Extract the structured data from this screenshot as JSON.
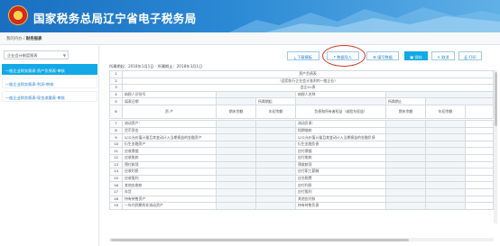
{
  "app": {
    "title": "国家税务总局辽宁省电子税务局"
  },
  "breadcrumb": {
    "home": "我的待办",
    "sep": "/",
    "current": "财务报表"
  },
  "sidebar": {
    "type_select": "企业会计制度报表",
    "items": [
      {
        "label": "一般企业财务报表-资产负债表-审核"
      },
      {
        "label": "一般企业财务报表-利润-审核"
      },
      {
        "label": "一般企业财务报表-现金流量表-审核"
      }
    ]
  },
  "toolbar": {
    "download": "下载模板",
    "import": "数据导入",
    "history": "填写数据",
    "save": "保存",
    "cancel": "取消",
    "print": "打印"
  },
  "period": {
    "text": "所属期起：2018年1月1日 - 所属期止：2018年3月1日"
  },
  "sheet": {
    "title": "资产负债表",
    "subtitle": "（适用执行企业会计准则的一般企业）",
    "unit": "会企01表",
    "row4": {
      "a": "纳税人识别号",
      "b": "纳税人名称"
    },
    "row5": {
      "a": "填表日期",
      "b": "所属期起",
      "c": "所属期止"
    },
    "row6": {
      "asset": "资 产",
      "end": "期末余额",
      "begin": "年初余额",
      "liab": "负债和所有者权益（或股东权益）",
      "end2": "期末余额",
      "begin2": "年初余额"
    },
    "items": [
      {
        "n": "7",
        "a": "流动资产：",
        "b": "流动负债："
      },
      {
        "n": "8",
        "a": "货币资金",
        "b": "短期借款"
      },
      {
        "n": "9",
        "a": "以公允价值计量且其变动计入当期损益的金融资产",
        "b": "以公允价值计量且其变动计入当期损益的金融负债"
      },
      {
        "n": "10",
        "a": "衍生金融资产",
        "b": "衍生金融负债"
      },
      {
        "n": "11",
        "a": "应收票据",
        "b": "应付票据"
      },
      {
        "n": "12",
        "a": "应收账款",
        "b": "应付账款"
      },
      {
        "n": "13",
        "a": "预付款项",
        "b": "预收款项"
      },
      {
        "n": "14",
        "a": "应收利息",
        "b": "应付职工薪酬"
      },
      {
        "n": "15",
        "a": "应收股利",
        "b": "应交税费"
      },
      {
        "n": "16",
        "a": "其他应收款",
        "b": "应付利息"
      },
      {
        "n": "17",
        "a": "存货",
        "b": "应付股利"
      },
      {
        "n": "18",
        "a": "持有待售资产",
        "b": "其他应付款"
      },
      {
        "n": "19",
        "a": "一年内到期的非流动资产",
        "b": "持有待售负债"
      }
    ]
  },
  "colors": {
    "header": "#1a6fc0",
    "accent": "#12a9e6",
    "highlight": "#d83a2c"
  }
}
